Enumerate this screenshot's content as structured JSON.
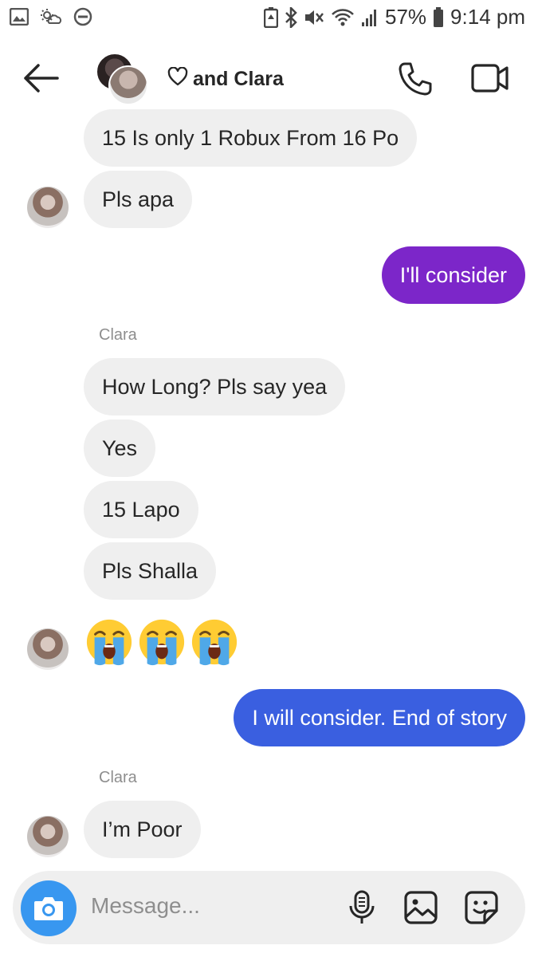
{
  "status_bar": {
    "battery_percent": "57%",
    "time": "9:14 pm"
  },
  "header": {
    "title": "and Clara",
    "heart_icon": "heart-outline-icon"
  },
  "messages": [
    {
      "side": "in",
      "text": "15 Is only 1 Robux From 16 Po"
    },
    {
      "side": "in",
      "text": "Pls apa"
    },
    {
      "side": "out",
      "text": "I'll consider"
    },
    {
      "side": "sender",
      "text": "Clara"
    },
    {
      "side": "in",
      "text": "How Long? Pls say yea"
    },
    {
      "side": "in",
      "text": "Yes"
    },
    {
      "side": "in",
      "text": "15 Lapo"
    },
    {
      "side": "in",
      "text": "Pls Shalla"
    },
    {
      "side": "in",
      "text": "😭😭😭"
    },
    {
      "side": "out",
      "text": "I will consider. End of story"
    },
    {
      "side": "sender",
      "text": "Clara"
    },
    {
      "side": "in",
      "text": "I’m Poor"
    }
  ],
  "composer": {
    "placeholder": "Message..."
  },
  "colors": {
    "outgoing_purple": "#7c26c9",
    "outgoing_blue": "#3a5fe0",
    "incoming_gray": "#efefef",
    "camera_blue": "#3897f0"
  }
}
